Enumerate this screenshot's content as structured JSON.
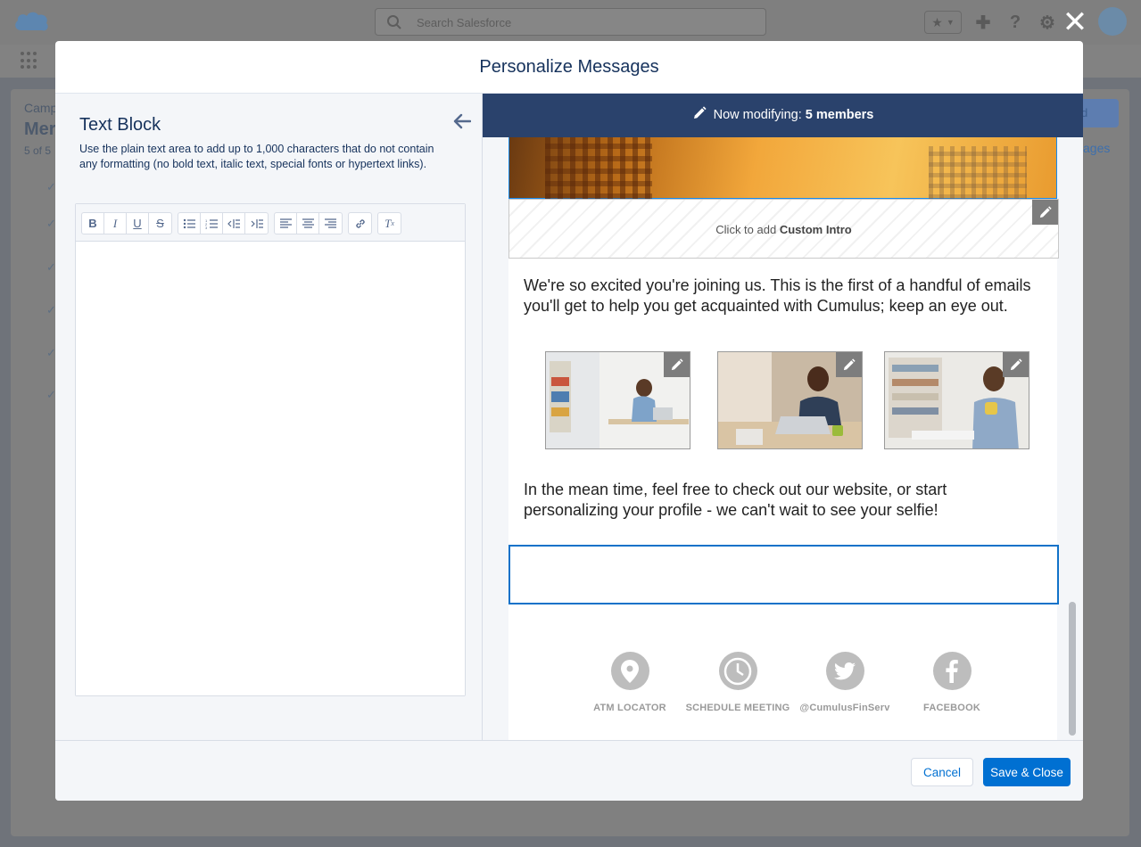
{
  "background": {
    "search_placeholder": "Search Salesforce",
    "breadcrumb_fragment": "Camp",
    "title_fragment": "Mer",
    "count_fragment": "5 of 5",
    "button_fragment": "d",
    "link_fragment": "ages"
  },
  "modal": {
    "title": "Personalize Messages",
    "close_icon": "close-icon"
  },
  "left_panel": {
    "title": "Text Block",
    "description": "Use the plain text area to add up to 1,000 characters that do not contain any formatting (no bold text, italic text, special fonts or hypertext links).",
    "toolbar": {
      "groups": [
        [
          "bold-icon",
          "italic-icon",
          "underline-icon",
          "strikethrough-icon"
        ],
        [
          "bulleted-list-icon",
          "numbered-list-icon",
          "outdent-icon",
          "indent-icon"
        ],
        [
          "align-left-icon",
          "align-center-icon",
          "align-right-icon"
        ],
        [
          "link-icon"
        ],
        [
          "clear-format-icon"
        ]
      ]
    },
    "editor_value": ""
  },
  "right_panel": {
    "banner_prefix": "Now modifying: ",
    "banner_count": "5 members",
    "custom_intro_prefix": "Click to add ",
    "custom_intro_name": "Custom Intro",
    "paragraph_1": "We're so excited you're joining us. This is the first of a handful of emails you'll get to help you get acquainted with Cumulus; keep an eye out.",
    "paragraph_2": "In the mean time, feel free to check out our website, or start personalizing your profile - we can't wait to see your selfie!",
    "social": [
      {
        "label": "ATM LOCATOR",
        "icon": "map-pin-icon"
      },
      {
        "label": "SCHEDULE MEETING",
        "icon": "clock-icon"
      },
      {
        "label": "@CumulusFinServ",
        "icon": "twitter-icon"
      },
      {
        "label": "FACEBOOK",
        "icon": "facebook-icon"
      }
    ]
  },
  "footer": {
    "cancel_label": "Cancel",
    "save_label": "Save & Close"
  },
  "colors": {
    "banner": "#2a426c",
    "brand_blue": "#0070d2",
    "selection_border": "#1172c9"
  }
}
